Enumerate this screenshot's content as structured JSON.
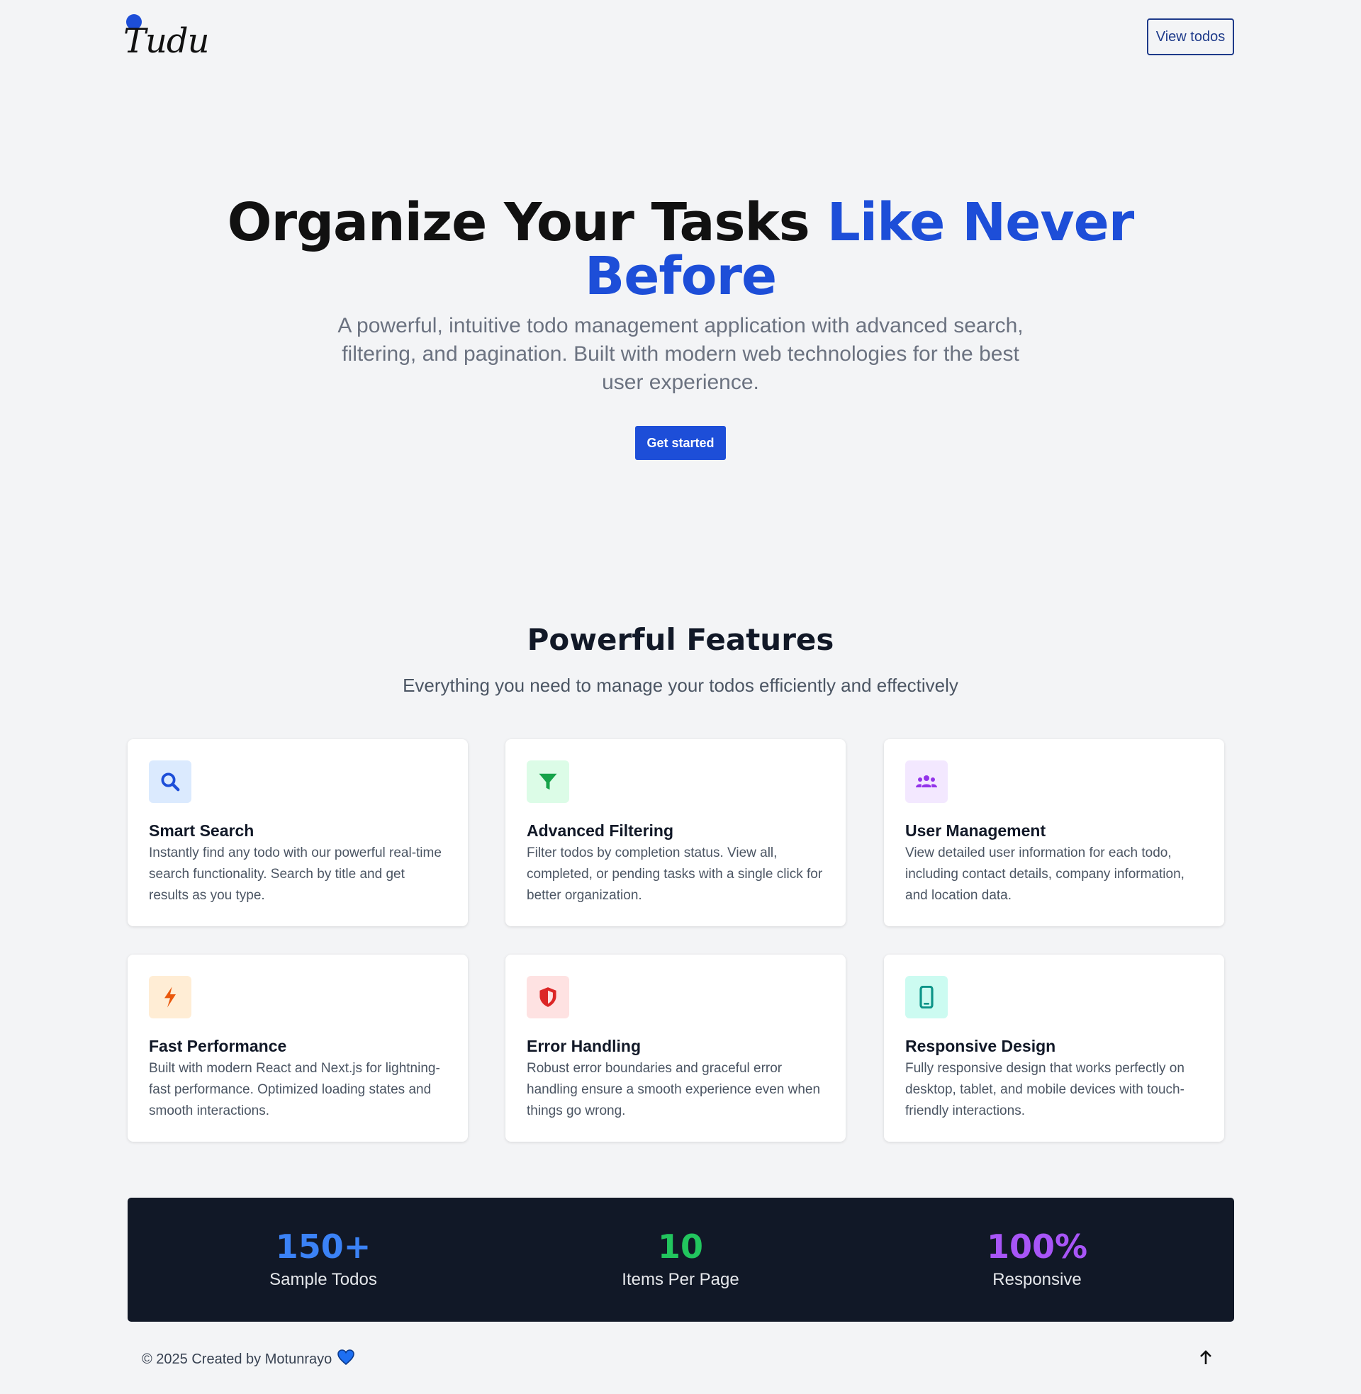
{
  "header": {
    "logo_text": "Tudu",
    "view_todos_label": "View todos"
  },
  "hero": {
    "title_part1": "Organize Your Tasks ",
    "title_accent": "Like Never Before",
    "subtitle": "A powerful, intuitive todo management application with advanced search, filtering, and pagination. Built with modern web technologies for the best user experience.",
    "cta_label": "Get started"
  },
  "features": {
    "title": "Powerful Features",
    "subtitle": "Everything you need to manage your todos efficiently and effectively",
    "items": [
      {
        "icon": "search-icon",
        "icon_bg": "#dbeafe",
        "icon_color": "#1d4ed8",
        "title": "Smart Search",
        "description": "Instantly find any todo with our powerful real-time search functionality. Search by title and get results as you type."
      },
      {
        "icon": "filter-icon",
        "icon_bg": "#dcfce7",
        "icon_color": "#16a34a",
        "title": "Advanced Filtering",
        "description": "Filter todos by completion status. View all, completed, or pending tasks with a single click for better organization."
      },
      {
        "icon": "users-icon",
        "icon_bg": "#f3e8ff",
        "icon_color": "#9333ea",
        "title": "User Management",
        "description": "View detailed user information for each todo, including contact details, company information, and location data."
      },
      {
        "icon": "lightning-icon",
        "icon_bg": "#ffedd5",
        "icon_color": "#ea580c",
        "title": "Fast Performance",
        "description": "Built with modern React and Next.js for lightning-fast performance. Optimized loading states and smooth interactions."
      },
      {
        "icon": "shield-icon",
        "icon_bg": "#fee2e2",
        "icon_color": "#dc2626",
        "title": "Error Handling",
        "description": "Robust error boundaries and graceful error handling ensure a smooth experience even when things go wrong."
      },
      {
        "icon": "mobile-icon",
        "icon_bg": "#ccfbf1",
        "icon_color": "#0d9488",
        "title": "Responsive Design",
        "description": "Fully responsive design that works perfectly on desktop, tablet, and mobile devices with touch-friendly interactions."
      }
    ]
  },
  "stats": [
    {
      "value": "150+",
      "label": "Sample Todos",
      "color": "#3b82f6"
    },
    {
      "value": "10",
      "label": "Items Per Page",
      "color": "#22c55e"
    },
    {
      "value": "100%",
      "label": "Responsive",
      "color": "#a855f7"
    }
  ],
  "footer": {
    "text": "© 2025 Created by Motunrayo",
    "heart_icon": "heart-icon",
    "scroll_top_icon": "arrow-up-icon"
  }
}
